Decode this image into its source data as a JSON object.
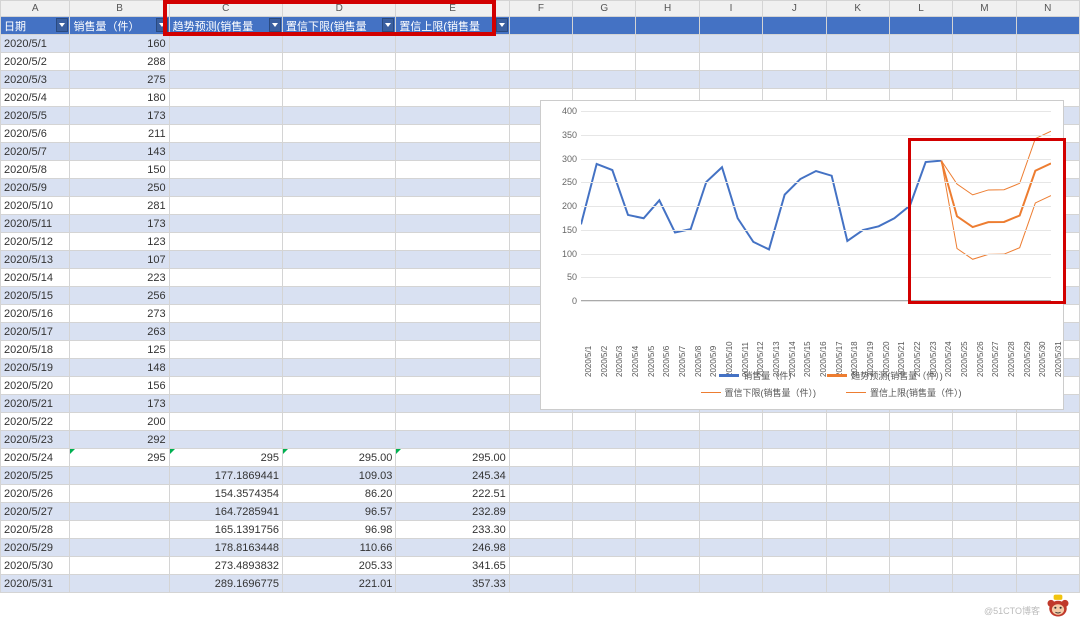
{
  "columns_letters": [
    "A",
    "B",
    "C",
    "D",
    "E",
    "F",
    "G",
    "H",
    "I",
    "J",
    "K",
    "L",
    "M",
    "N"
  ],
  "headers": {
    "A": "日期",
    "B": "销售量（件）",
    "C": "趋势预测(销售量",
    "D": "置信下限(销售量",
    "E": "置信上限(销售量"
  },
  "rows": [
    {
      "date": "2020/5/1",
      "sales": 160,
      "band": true
    },
    {
      "date": "2020/5/2",
      "sales": 288
    },
    {
      "date": "2020/5/3",
      "sales": 275,
      "band": true
    },
    {
      "date": "2020/5/4",
      "sales": 180
    },
    {
      "date": "2020/5/5",
      "sales": 173,
      "band": true
    },
    {
      "date": "2020/5/6",
      "sales": 211
    },
    {
      "date": "2020/5/7",
      "sales": 143,
      "band": true
    },
    {
      "date": "2020/5/8",
      "sales": 150
    },
    {
      "date": "2020/5/9",
      "sales": 250,
      "band": true
    },
    {
      "date": "2020/5/10",
      "sales": 281
    },
    {
      "date": "2020/5/11",
      "sales": 173,
      "band": true
    },
    {
      "date": "2020/5/12",
      "sales": 123
    },
    {
      "date": "2020/5/13",
      "sales": 107,
      "band": true
    },
    {
      "date": "2020/5/14",
      "sales": 223
    },
    {
      "date": "2020/5/15",
      "sales": 256,
      "band": true
    },
    {
      "date": "2020/5/16",
      "sales": 273
    },
    {
      "date": "2020/5/17",
      "sales": 263,
      "band": true
    },
    {
      "date": "2020/5/18",
      "sales": 125
    },
    {
      "date": "2020/5/19",
      "sales": 148,
      "band": true
    },
    {
      "date": "2020/5/20",
      "sales": 156
    },
    {
      "date": "2020/5/21",
      "sales": 173,
      "band": true
    },
    {
      "date": "2020/5/22",
      "sales": 200
    },
    {
      "date": "2020/5/23",
      "sales": 292,
      "band": true
    },
    {
      "date": "2020/5/24",
      "sales": 295,
      "forecast": "295",
      "lower": "295.00",
      "upper": "295.00",
      "mark": true
    },
    {
      "date": "2020/5/25",
      "forecast": "177.1869441",
      "lower": "109.03",
      "upper": "245.34",
      "band": true
    },
    {
      "date": "2020/5/26",
      "forecast": "154.3574354",
      "lower": "86.20",
      "upper": "222.51"
    },
    {
      "date": "2020/5/27",
      "forecast": "164.7285941",
      "lower": "96.57",
      "upper": "232.89",
      "band": true
    },
    {
      "date": "2020/5/28",
      "forecast": "165.1391756",
      "lower": "96.98",
      "upper": "233.30"
    },
    {
      "date": "2020/5/29",
      "forecast": "178.8163448",
      "lower": "110.66",
      "upper": "246.98",
      "band": true
    },
    {
      "date": "2020/5/30",
      "forecast": "273.4893832",
      "lower": "205.33",
      "upper": "341.65"
    },
    {
      "date": "2020/5/31",
      "forecast": "289.1696775",
      "lower": "221.01",
      "upper": "357.33",
      "band": true
    }
  ],
  "chart_data": {
    "type": "line",
    "y_ticks": [
      0,
      50,
      100,
      150,
      200,
      250,
      300,
      350,
      400
    ],
    "ylim": [
      0,
      400
    ],
    "categories": [
      "2020/5/1",
      "2020/5/2",
      "2020/5/3",
      "2020/5/4",
      "2020/5/5",
      "2020/5/6",
      "2020/5/7",
      "2020/5/8",
      "2020/5/9",
      "2020/5/10",
      "2020/5/11",
      "2020/5/12",
      "2020/5/13",
      "2020/5/14",
      "2020/5/15",
      "2020/5/16",
      "2020/5/17",
      "2020/5/18",
      "2020/5/19",
      "2020/5/20",
      "2020/5/21",
      "2020/5/22",
      "2020/5/23",
      "2020/5/24",
      "2020/5/25",
      "2020/5/26",
      "2020/5/27",
      "2020/5/28",
      "2020/5/29",
      "2020/5/30",
      "2020/5/31"
    ],
    "series": [
      {
        "name": "销售量（件）",
        "color": "#4472c4",
        "width": 2,
        "values": [
          160,
          288,
          275,
          180,
          173,
          211,
          143,
          150,
          250,
          281,
          173,
          123,
          107,
          223,
          256,
          273,
          263,
          125,
          148,
          156,
          173,
          200,
          292,
          295,
          null,
          null,
          null,
          null,
          null,
          null,
          null
        ]
      },
      {
        "name": "趋势预测(销售量（件）)",
        "color": "#ed7d31",
        "width": 2,
        "start": 23,
        "values": [
          295,
          177.19,
          154.36,
          164.73,
          165.14,
          178.82,
          273.49,
          289.17
        ]
      },
      {
        "name": "置信下限(销售量（件）)",
        "color": "#ed7d31",
        "width": 1,
        "start": 23,
        "values": [
          295,
          109.03,
          86.2,
          96.57,
          96.98,
          110.66,
          205.33,
          221.01
        ]
      },
      {
        "name": "置信上限(销售量（件）)",
        "color": "#ed7d31",
        "width": 1,
        "start": 23,
        "values": [
          295,
          245.34,
          222.51,
          232.89,
          233.3,
          246.98,
          341.65,
          357.33
        ]
      }
    ]
  },
  "watermark": "@51CTO博客"
}
